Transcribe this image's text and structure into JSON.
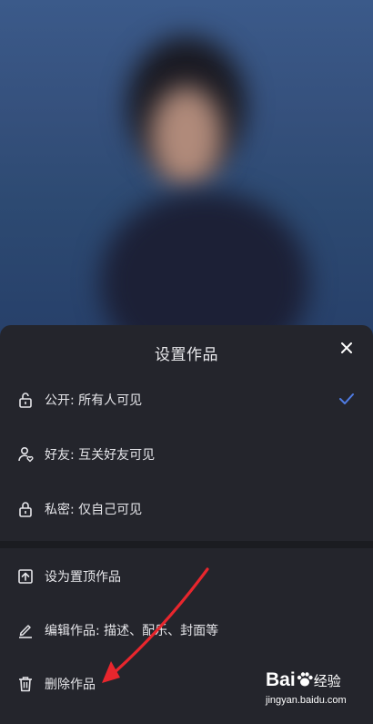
{
  "sheet": {
    "title": "设置作品",
    "close_icon": "close-icon",
    "privacy_options": [
      {
        "label": "公开: 所有人可见",
        "icon": "unlock-icon",
        "selected": true
      },
      {
        "label": "好友: 互关好友可见",
        "icon": "friends-icon",
        "selected": false
      },
      {
        "label": "私密: 仅自己可见",
        "icon": "lock-icon",
        "selected": false
      }
    ],
    "actions": [
      {
        "label": "设为置顶作品",
        "icon": "pin-top-icon"
      },
      {
        "label": "编辑作品: 描述、配乐、封面等",
        "icon": "edit-icon"
      },
      {
        "label": "删除作品",
        "icon": "trash-icon"
      }
    ]
  },
  "colors": {
    "sheet_bg": "#24252c",
    "check_accent": "#4f7be3",
    "annotation_arrow": "#e8262d"
  },
  "watermark": {
    "brand": "Bai",
    "brand_suffix": "经验",
    "url": "jingyan.baidu.com"
  }
}
